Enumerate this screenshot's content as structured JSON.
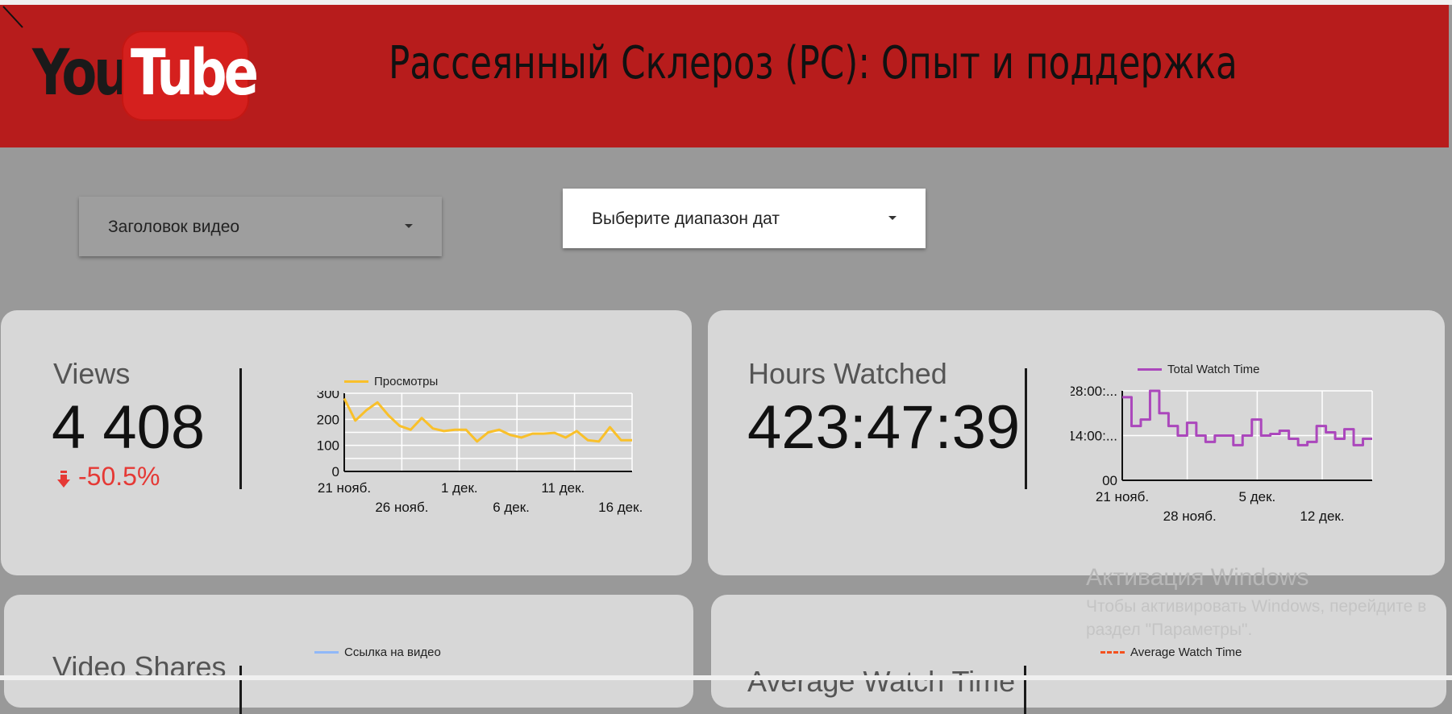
{
  "header": {
    "logo_you": "You",
    "logo_tube": "Tube",
    "title": "Рассеянный Склероз (РС): Опыт и поддержка",
    "bg_color": "#b71c1c"
  },
  "filters": {
    "video_title": "Заголовок видео",
    "date_range": "Выберите диапазон дат"
  },
  "cards": {
    "views": {
      "label": "Views",
      "value": "4 408",
      "change": "-50.5%",
      "change_icon": "down-arrow-icon"
    },
    "hours": {
      "label": "Hours Watched",
      "value": "423:47:39"
    },
    "shares": {
      "label": "Video Shares",
      "legend": "Ссылка на видео",
      "legend_color": "#90b8f8"
    },
    "avg": {
      "label": "Average Watch Time",
      "legend": "Average Watch Time",
      "legend_color": "#f4511e"
    }
  },
  "watermark": {
    "title": "Активация Windows",
    "line1": "Чтобы активировать Windows, перейдите в",
    "line2": "раздел \"Параметры\"."
  },
  "chart_data": [
    {
      "type": "line",
      "series": [
        {
          "name": "Просмотры",
          "color": "#f9c02a",
          "values": [
            280,
            195,
            235,
            265,
            215,
            175,
            160,
            205,
            165,
            155,
            160,
            160,
            115,
            150,
            160,
            140,
            130,
            145,
            145,
            148,
            130,
            155,
            120,
            115,
            170,
            120,
            120
          ]
        }
      ],
      "ylim": [
        0,
        300
      ],
      "yticks": [
        "300",
        "200",
        "100",
        "0"
      ],
      "xticks_top": [
        "21 нояб.",
        "1 дек.",
        "11 дек."
      ],
      "xticks_bottom": [
        "26 нояб.",
        "6 дек.",
        "16 дек."
      ]
    },
    {
      "type": "line",
      "step": true,
      "series": [
        {
          "name": "Total Watch Time",
          "color": "#ab47bc",
          "values": [
            26,
            17,
            19,
            28,
            21,
            17,
            14,
            18,
            14,
            12,
            14,
            14,
            11,
            14,
            19,
            14,
            14.5,
            15.5,
            13,
            11,
            12,
            17,
            15,
            13,
            16,
            11,
            13
          ]
        }
      ],
      "ylim": [
        0,
        28
      ],
      "yticks": [
        "28:00:...",
        "14:00:...",
        "00"
      ],
      "xticks_top": [
        "21 нояб.",
        "5 дек."
      ],
      "xticks_bottom": [
        "28 нояб.",
        "12 дек."
      ]
    }
  ]
}
